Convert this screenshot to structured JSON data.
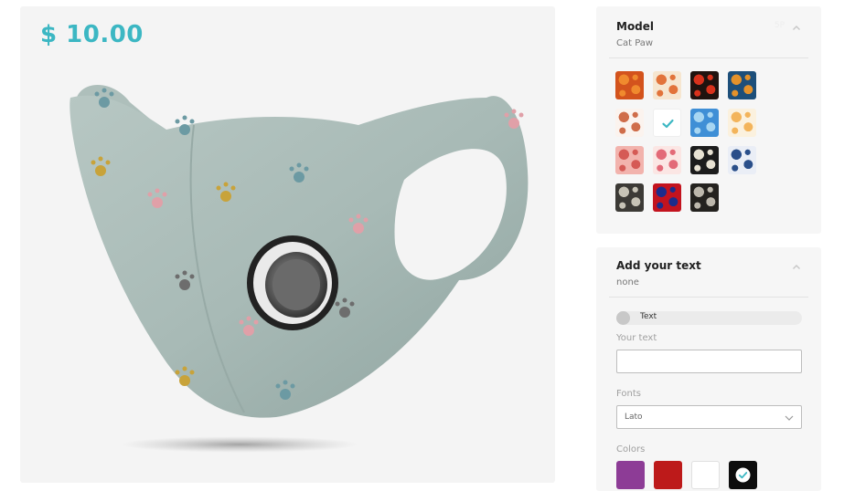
{
  "product": {
    "price": "$ 10.00"
  },
  "model_panel": {
    "title": "Model",
    "selected": "Cat Paw",
    "sku": "5P",
    "swatches": [
      {
        "name": "orange-rings",
        "c1": "#d3531d",
        "c2": "#f08a2e",
        "selected": false
      },
      {
        "name": "autumn-leaves",
        "c1": "#f6e6d0",
        "c2": "#e2733a",
        "selected": false
      },
      {
        "name": "christmas-sweater",
        "c1": "#20130f",
        "c2": "#d8321c",
        "selected": false
      },
      {
        "name": "blue-tribal",
        "c1": "#1d4f7a",
        "c2": "#e4922b",
        "selected": false
      },
      {
        "name": "maple-leaves",
        "c1": "#fbf3ee",
        "c2": "#cf6d4a",
        "selected": false
      },
      {
        "name": "cat-paw",
        "c1": "#ffffff",
        "c2": "#3cb7c3",
        "selected": true
      },
      {
        "name": "blue-watercolor",
        "c1": "#3f8fd6",
        "c2": "#a7d6f2",
        "selected": false
      },
      {
        "name": "hearts",
        "c1": "#fbf1de",
        "c2": "#f3b45b",
        "selected": false
      },
      {
        "name": "pink-floral",
        "c1": "#f2b3ad",
        "c2": "#d55a55",
        "selected": false
      },
      {
        "name": "pink-brush",
        "c1": "#fbe6e4",
        "c2": "#e36a78",
        "selected": false
      },
      {
        "name": "dark-camo",
        "c1": "#1c1c1c",
        "c2": "#e8e2d3",
        "selected": false
      },
      {
        "name": "blue-wave",
        "c1": "#eaeef6",
        "c2": "#2a4f8a",
        "selected": false
      },
      {
        "name": "grey-camo",
        "c1": "#3c3a36",
        "c2": "#c7c3b6",
        "selected": false
      },
      {
        "name": "spider-hero",
        "c1": "#c3131e",
        "c2": "#1d2c8b",
        "selected": false
      },
      {
        "name": "urban-camo",
        "c1": "#24221f",
        "c2": "#bdb8ad",
        "selected": false
      }
    ]
  },
  "text_panel": {
    "title": "Add your text",
    "selected": "none",
    "toggle_label": "Text",
    "your_text_label": "Your text",
    "your_text_value": "",
    "fonts_label": "Fonts",
    "font_value": "Lato",
    "colors_label": "Colors",
    "colors": [
      {
        "name": "purple",
        "hex": "#8d3c96",
        "selected": false
      },
      {
        "name": "red",
        "hex": "#bd1a1a",
        "selected": false
      },
      {
        "name": "white",
        "hex": "#ffffff",
        "selected": false
      },
      {
        "name": "black",
        "hex": "#0d0d0d",
        "selected": true
      }
    ]
  },
  "accent_color": "#3cb7c3"
}
